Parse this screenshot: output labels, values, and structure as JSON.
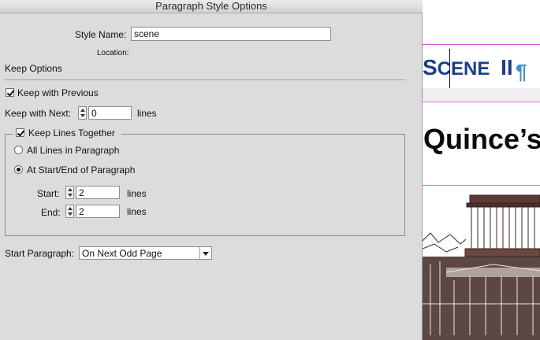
{
  "dialog": {
    "title": "Paragraph Style Options",
    "style_name_label": "Style Name:",
    "style_name_value": "scene",
    "location_label": "Location:",
    "section_title": "Keep Options",
    "keep_with_previous": {
      "label": "Keep with Previous",
      "checked": true
    },
    "keep_with_next": {
      "label": "Keep with Next:",
      "value": "0",
      "unit": "lines"
    },
    "keep_lines_together": {
      "label": "Keep Lines Together",
      "checked": true,
      "option_all": {
        "label": "All Lines in Paragraph",
        "selected": false
      },
      "option_start_end": {
        "label": "At Start/End of Paragraph",
        "selected": true
      },
      "start": {
        "label": "Start:",
        "value": "2",
        "unit": "lines"
      },
      "end": {
        "label": "End:",
        "value": "2",
        "unit": "lines"
      }
    },
    "start_paragraph": {
      "label": "Start Paragraph:",
      "value": "On Next Odd Page"
    }
  },
  "document": {
    "heading_cap_s": "S",
    "heading_rest": "CENE",
    "heading_numeral": "II",
    "subheading": "Quince’s",
    "colors": {
      "heading": "#1c3d8f",
      "pilcrow": "#3c8fd7",
      "magenta_guide": "#d257d9",
      "cyan_guide": "#45b8e8"
    }
  }
}
